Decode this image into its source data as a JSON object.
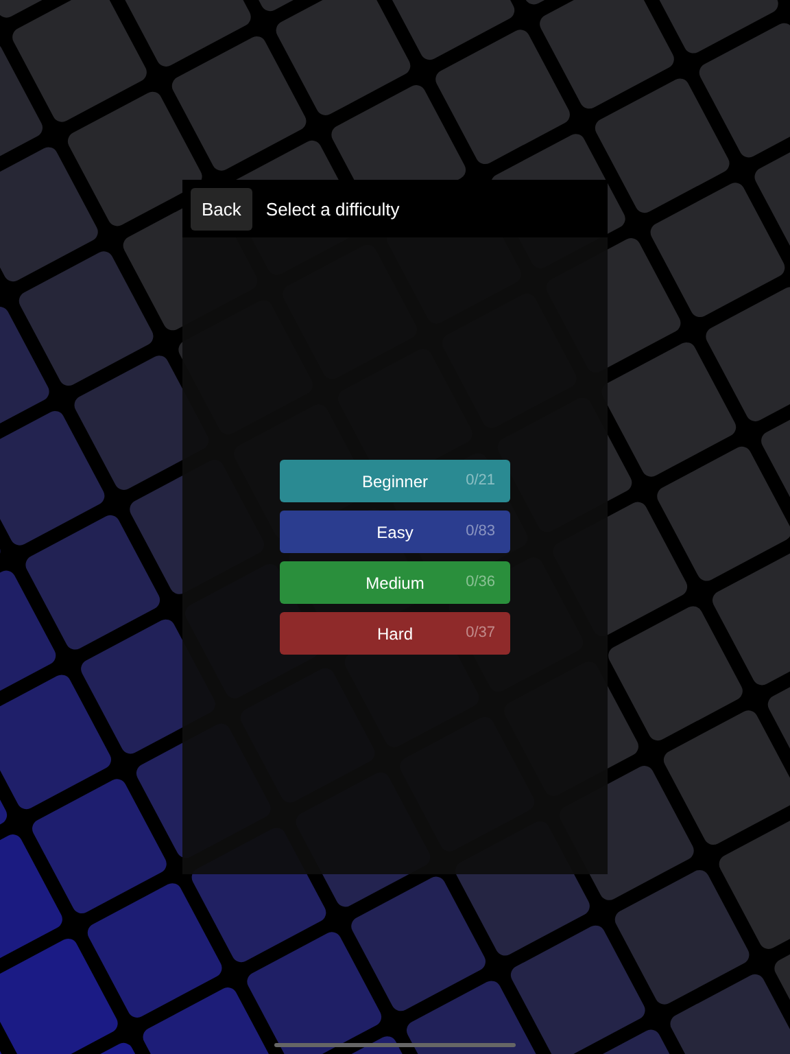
{
  "header": {
    "back_button": "Back",
    "title": "Select a difficulty"
  },
  "difficulties": [
    {
      "label": "Beginner",
      "progress": "0/21",
      "color": "#2a8a92"
    },
    {
      "label": "Easy",
      "progress": "0/83",
      "color": "#2b3d8f"
    },
    {
      "label": "Medium",
      "progress": "0/36",
      "color": "#2a8f3c"
    },
    {
      "label": "Hard",
      "progress": "0/37",
      "color": "#8f2a2a"
    }
  ]
}
